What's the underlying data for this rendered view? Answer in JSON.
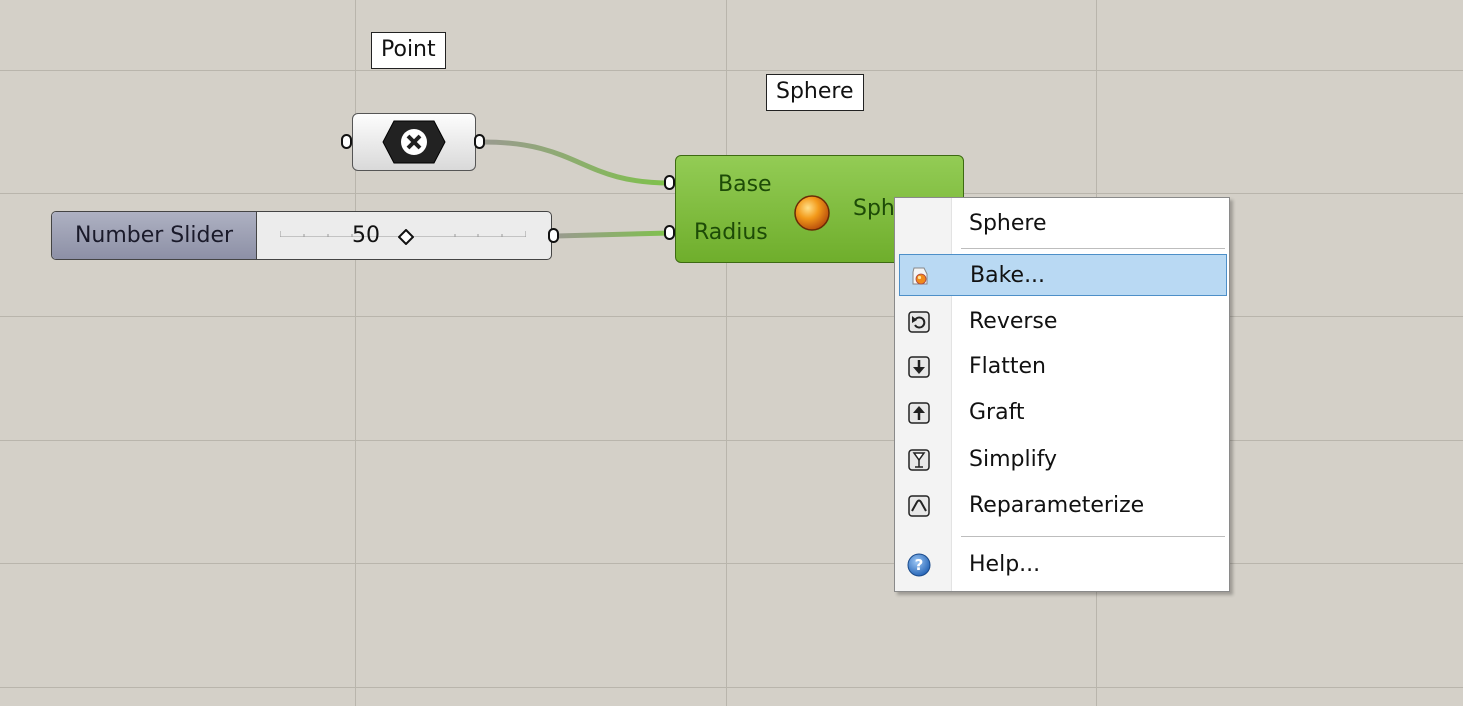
{
  "tags": {
    "point": "Point",
    "sphere": "Sphere"
  },
  "point_node": {
    "icon": "cross-hexagon-icon"
  },
  "number_slider": {
    "label": "Number Slider",
    "value": "50"
  },
  "sphere_node": {
    "inputs": [
      "Base",
      "Radius"
    ],
    "output": "Sph",
    "icon": "sphere-icon"
  },
  "context_menu": {
    "title": "Sphere",
    "items": [
      {
        "label": "Bake...",
        "icon": "bake-icon",
        "highlighted": true
      },
      {
        "label": "Reverse",
        "icon": "reverse-icon"
      },
      {
        "label": "Flatten",
        "icon": "flatten-icon"
      },
      {
        "label": "Graft",
        "icon": "graft-icon"
      },
      {
        "label": "Simplify",
        "icon": "simplify-icon"
      },
      {
        "label": "Reparameterize",
        "icon": "reparameterize-icon"
      },
      {
        "label": "Help...",
        "icon": "help-icon"
      }
    ]
  },
  "colors": {
    "canvas": "#d4d0c8",
    "component_green": "#7fbd3c",
    "wire_green": "#84c15a",
    "menu_highlight": "#b9d9f3"
  }
}
